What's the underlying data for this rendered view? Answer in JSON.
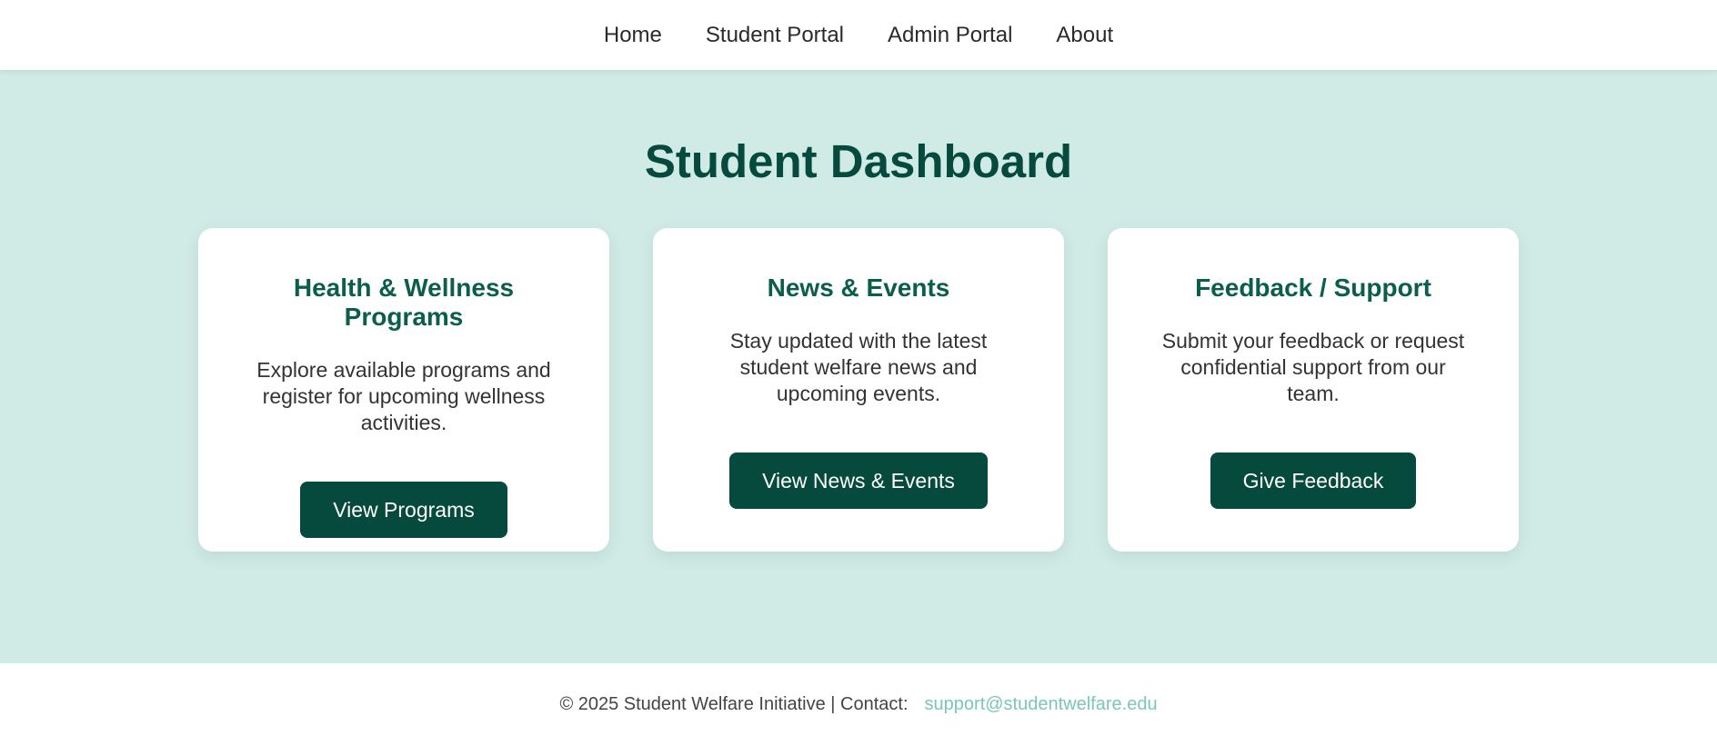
{
  "nav": {
    "items": [
      {
        "label": "Home"
      },
      {
        "label": "Student Portal"
      },
      {
        "label": "Admin Portal"
      },
      {
        "label": "About"
      }
    ]
  },
  "main": {
    "title": "Student Dashboard",
    "cards": [
      {
        "title": "Health & Wellness Programs",
        "description": "Explore available programs and register for upcoming wellness activities.",
        "button": "View Programs"
      },
      {
        "title": "News & Events",
        "description": "Stay updated with the latest student welfare news and upcoming events.",
        "button": "View News & Events"
      },
      {
        "title": "Feedback / Support",
        "description": "Submit your feedback or request confidential support from our team.",
        "button": "Give Feedback"
      }
    ]
  },
  "footer": {
    "text": "© 2025 Student Welfare Initiative | Contact:",
    "email": "support@studentwelfare.edu"
  },
  "colors": {
    "primary": "#064a3e",
    "heading": "#0b5e4b",
    "background": "#d0ebe6",
    "link": "#7cc6b4"
  }
}
